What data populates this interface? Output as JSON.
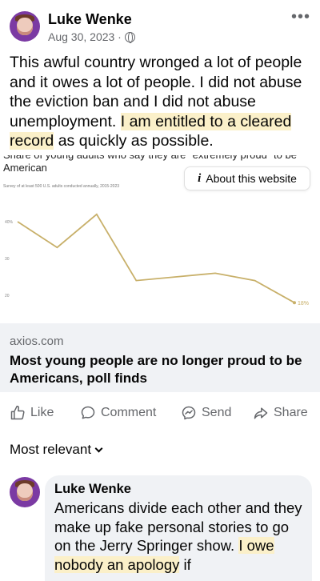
{
  "post": {
    "author": "Luke Wenke",
    "date": "Aug 30, 2023 ·",
    "text_plain": "This awful country wronged a lot of people and it owes a lot of people.  I did not abuse the eviction ban and I did not abuse unemployment. ",
    "text_highlight_1": "I am entitled to a cleared record",
    "text_tail": " as quickly as possible."
  },
  "preview": {
    "chart_title": "Share of young adults who say they are \"extremely proud\" to be American",
    "chart_subtitle": "Survey of at least 500 U.S. adults conducted annually, 2015-2023",
    "about_button": "About this website",
    "highlight_color": "#fbf0c9"
  },
  "chart_data": {
    "type": "line",
    "title": "Share of young adults who say they are \"extremely proud\" to be American",
    "subtitle": "Survey of at least 500 U.S. adults conducted annually, 2015-2023",
    "y_tick_labels": [
      "40%",
      "30",
      "20"
    ],
    "series": [
      {
        "color": "#c8b06a",
        "values": [
          40,
          33,
          42,
          24,
          25,
          26,
          24,
          18
        ]
      }
    ],
    "end_label": "18%",
    "ylim": [
      15,
      45
    ],
    "grid": false
  },
  "link": {
    "domain": "axios.com",
    "title": "Most young people are no longer proud to be Americans, poll finds"
  },
  "actions": {
    "like": "Like",
    "comment": "Comment",
    "send": "Send",
    "share": "Share"
  },
  "comments": {
    "sort_label": "Most relevant",
    "first": {
      "author": "Luke Wenke",
      "text_plain": "Americans divide each other and they make up fake personal stories to go on the Jerry Springer show. ",
      "text_highlight": "I owe nobody an apology",
      "text_tail": " if"
    }
  }
}
